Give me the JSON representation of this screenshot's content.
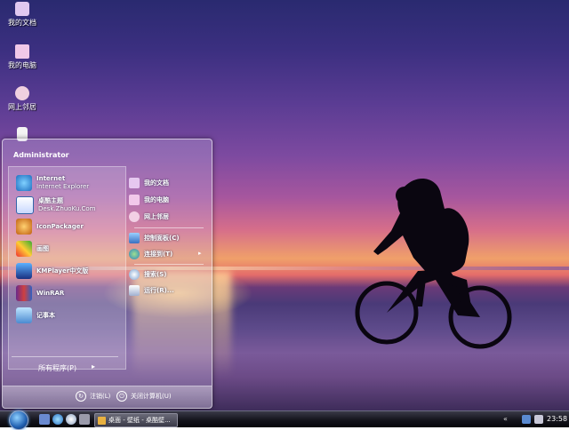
{
  "desktop": {
    "icons": [
      {
        "label": "我的文档"
      },
      {
        "label": "我的电脑"
      },
      {
        "label": "网上邻居"
      }
    ]
  },
  "start_menu": {
    "user": "Administrator",
    "programs": [
      {
        "title": "Internet",
        "subtitle": "Internet Explorer",
        "icon": "ie-icon"
      },
      {
        "title": "桌酷主题",
        "subtitle": "Desk.ZhuoKu.Com",
        "icon": "theme-icon"
      },
      {
        "title": "IconPackager",
        "subtitle": "",
        "icon": "iconpackager-icon"
      },
      {
        "title": "画图",
        "subtitle": "",
        "icon": "paint-icon"
      },
      {
        "title": "KMPlayer中文版",
        "subtitle": "",
        "icon": "kmplayer-icon"
      },
      {
        "title": "WinRAR",
        "subtitle": "",
        "icon": "winrar-icon"
      },
      {
        "title": "记事本",
        "subtitle": "",
        "icon": "notepad-icon"
      }
    ],
    "all_programs": "所有程序(P)",
    "right": [
      {
        "label": "我的文档",
        "icon": "documents-icon"
      },
      {
        "label": "我的电脑",
        "icon": "computer-icon"
      },
      {
        "label": "网上邻居",
        "icon": "network-icon"
      },
      {
        "label": "控制面板(C)",
        "icon": "control-panel-icon"
      },
      {
        "label": "连接到(T)",
        "icon": "connect-icon"
      },
      {
        "label": "搜索(S)",
        "icon": "search-icon"
      },
      {
        "label": "运行(R)...",
        "icon": "run-icon"
      }
    ],
    "logoff": "注销(L)",
    "shutdown": "关闭计算机(U)"
  },
  "taskbar": {
    "task_label": "桌面 - 壁纸 - 桌酷壁...",
    "clock": "23:58"
  },
  "colors": {
    "sky_top": "#2a2a70",
    "sunset": "#f0a06a",
    "taskbar": "#14141c"
  }
}
